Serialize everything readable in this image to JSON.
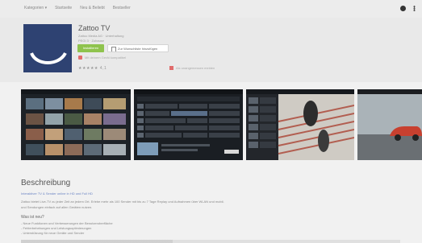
{
  "topnav": {
    "items": [
      "Kategorien ▾",
      "Startseite",
      "Neu & Beliebt",
      "Bestseller"
    ]
  },
  "app": {
    "title": "Zattoo TV",
    "developer": "Zattoo Media AG · Unterhaltung",
    "rating_label": "PEGI 3 · Zuhause",
    "install_label": "Installieren",
    "wishlist_label": "Zur Wunschliste hinzufügen",
    "compat_note": "Mit deinem Gerät kompatibel",
    "stars": "★★★★★ 4,1",
    "report_label": "Als unangemessen melden",
    "logo_color": "#2e4272"
  },
  "description": {
    "title": "Beschreibung",
    "lines": [
      "Interaktiver TV & Sender online in HD und Full HD",
      "Zattoo bietet Live-TV zu jeder Zeit an jedem Ort. Erlebe mehr als 100 Sender mit bis zu 7 Tage Replay und Aufnahmen über WLAN und mobil.",
      "und Sendungen einfach auf allen Geräten nutzen."
    ],
    "subheading": "Was ist neu?",
    "sub_lines": [
      "- Neue Funktionen und Verbesserungen der Benutzeroberfläche",
      "- Fehlerbehebungen und Leistungsoptimierungen",
      "- Unterstützung für neue Geräte und Sender"
    ]
  }
}
